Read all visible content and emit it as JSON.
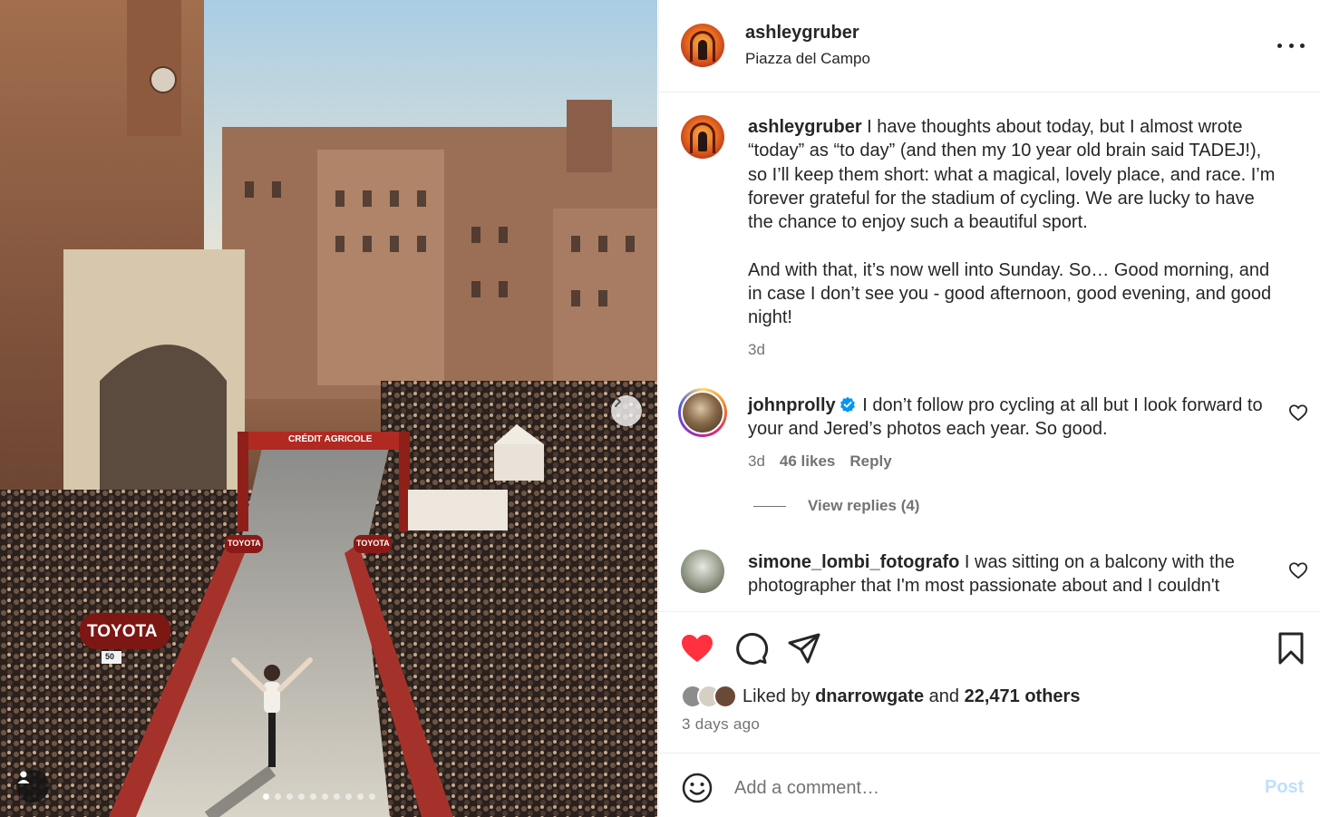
{
  "photo": {
    "banner_text": "CRÉDIT AGRICOLE",
    "brand_left": "TOYOTA",
    "brand_gate_left": "TOYOTA",
    "brand_gate_right": "TOYOTA",
    "sign_number": "50",
    "carousel": {
      "total": 10,
      "active_index": 0
    }
  },
  "header": {
    "username": "ashleygruber",
    "location": "Piazza del Campo"
  },
  "caption": {
    "username": "ashleygruber",
    "paragraph1": "I have thoughts about today, but I almost wrote “today” as “to day” (and then my 10 year old brain said TADEJ!), so I’ll keep them short: what a magical, lovely place, and race. I’m forever grateful for the stadium of cycling. We are lucky to have the chance to enjoy such a beautiful sport.",
    "paragraph2": "And with that, it’s now well into Sunday. So… Good morning, and in case I don’t see you - good afternoon, good evening, and good night!",
    "age": "3d"
  },
  "comments": [
    {
      "username": "johnprolly",
      "verified": true,
      "text": "I don’t follow pro cycling at all but I look forward to your and Jered’s photos each year. So good.",
      "age": "3d",
      "likes": "46 likes",
      "reply_label": "Reply",
      "view_replies": "View replies (4)"
    },
    {
      "username": "simone_lombi_fotografo",
      "verified": false,
      "text": "I was sitting on a balcony with the photographer that I'm most passionate about and I couldn't"
    }
  ],
  "likes": {
    "prefix": "Liked by",
    "first_user": "dnarrowgate",
    "connector": "and",
    "others": "22,471 others",
    "time": "3 days ago"
  },
  "add_comment": {
    "placeholder": "Add a comment…",
    "post_label": "Post"
  },
  "colors": {
    "like_red": "#ff3040",
    "post_disabled": "#c0dffd",
    "verified_blue": "#0095f6",
    "text_secondary": "#737373"
  },
  "icons": [
    "more-icon",
    "heart-icon",
    "comment-icon",
    "share-icon",
    "bookmark-icon",
    "emoji-icon",
    "verified-badge-icon",
    "chevron-right-icon",
    "user-icon"
  ]
}
